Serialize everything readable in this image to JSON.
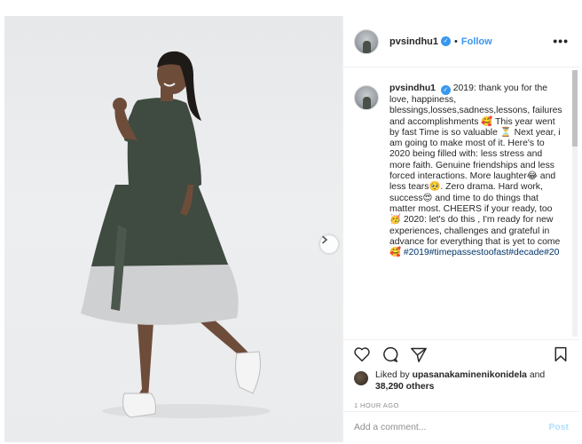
{
  "post": {
    "username": "pvsindhu1",
    "follow_label": "Follow",
    "separator": "•",
    "more_label": "•••"
  },
  "caption": {
    "username": "pvsindhu1",
    "text": "2019: thank you for the love, happiness, blessings,losses,sadness,lessons, failures and accomplishments 🥰 This year went by fast Time is so valuable ⏳ Next year, i am going to make most of it. Here's to 2020 being filled with: less stress and more faith. Genuine friendships and less forced interactions. More laughter😂 and less tears🥺. Zero drama. Hard work, success😍 and time to do things that matter most. CHEERS if your ready, too🥳 2020: let's do this , I'm ready for new experiences, challenges and grateful in advance for everything that is yet to come🥰",
    "hashtags": "#2019#timepassestoofast#decade#20"
  },
  "likes": {
    "prefix": "Liked by",
    "user": "upasanakaminenikonidela",
    "and": "and",
    "count": "38,290 others"
  },
  "timestamp": "1 HOUR AGO",
  "comment": {
    "placeholder": "Add a comment...",
    "post_label": "Post"
  },
  "icons": {
    "heart": "heart-icon",
    "comment": "comment-icon",
    "share": "share-icon",
    "save": "bookmark-icon",
    "next": "chevron-right-icon"
  },
  "carousel": {
    "slides": 5,
    "active": 1
  },
  "colors": {
    "accent": "#3897f0",
    "dress_top": "#3f4a40",
    "dress_bottom": "#cfd0d1"
  }
}
